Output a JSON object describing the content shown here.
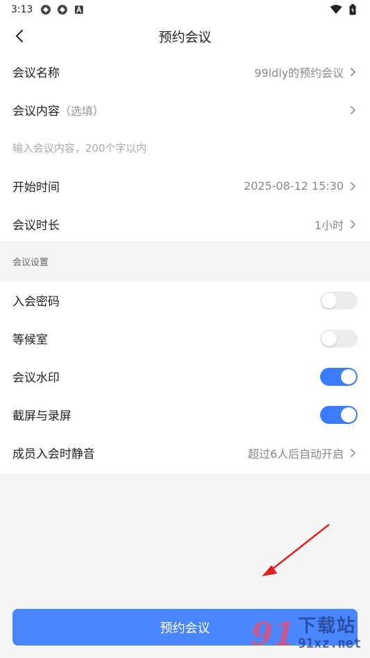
{
  "status_bar": {
    "time": "3:13",
    "left_icons": [
      "app-icon",
      "app-icon",
      "a-badge-icon"
    ],
    "right_icons": [
      "wifi-icon",
      "battery-icon"
    ]
  },
  "header": {
    "title": "预约会议",
    "back_icon": "chevron-left-icon"
  },
  "meeting": {
    "name_label": "会议名称",
    "name_value": "99ldly的预约会议",
    "content_label": "会议内容",
    "content_optional": "（选填）",
    "content_placeholder": "输入会议内容，200个字以内",
    "start_label": "开始时间",
    "start_value": "2025-08-12 15:30",
    "duration_label": "会议时长",
    "duration_value": "1小时"
  },
  "settings": {
    "group_title": "会议设置",
    "items": [
      {
        "label": "入会密码",
        "on": false
      },
      {
        "label": "等候室",
        "on": false
      },
      {
        "label": "会议水印",
        "on": true
      },
      {
        "label": "截屏与录屏",
        "on": true
      }
    ],
    "mute_label": "成员入会时静音",
    "mute_value": "超过6人后自动开启"
  },
  "submit_label": "预约会议",
  "watermark": {
    "logo": "91",
    "text": "下载站",
    "url": "91xz.net"
  },
  "colors": {
    "accent": "#3b7bff",
    "button": "#4a86ff",
    "annotation_arrow": "#e02020"
  }
}
